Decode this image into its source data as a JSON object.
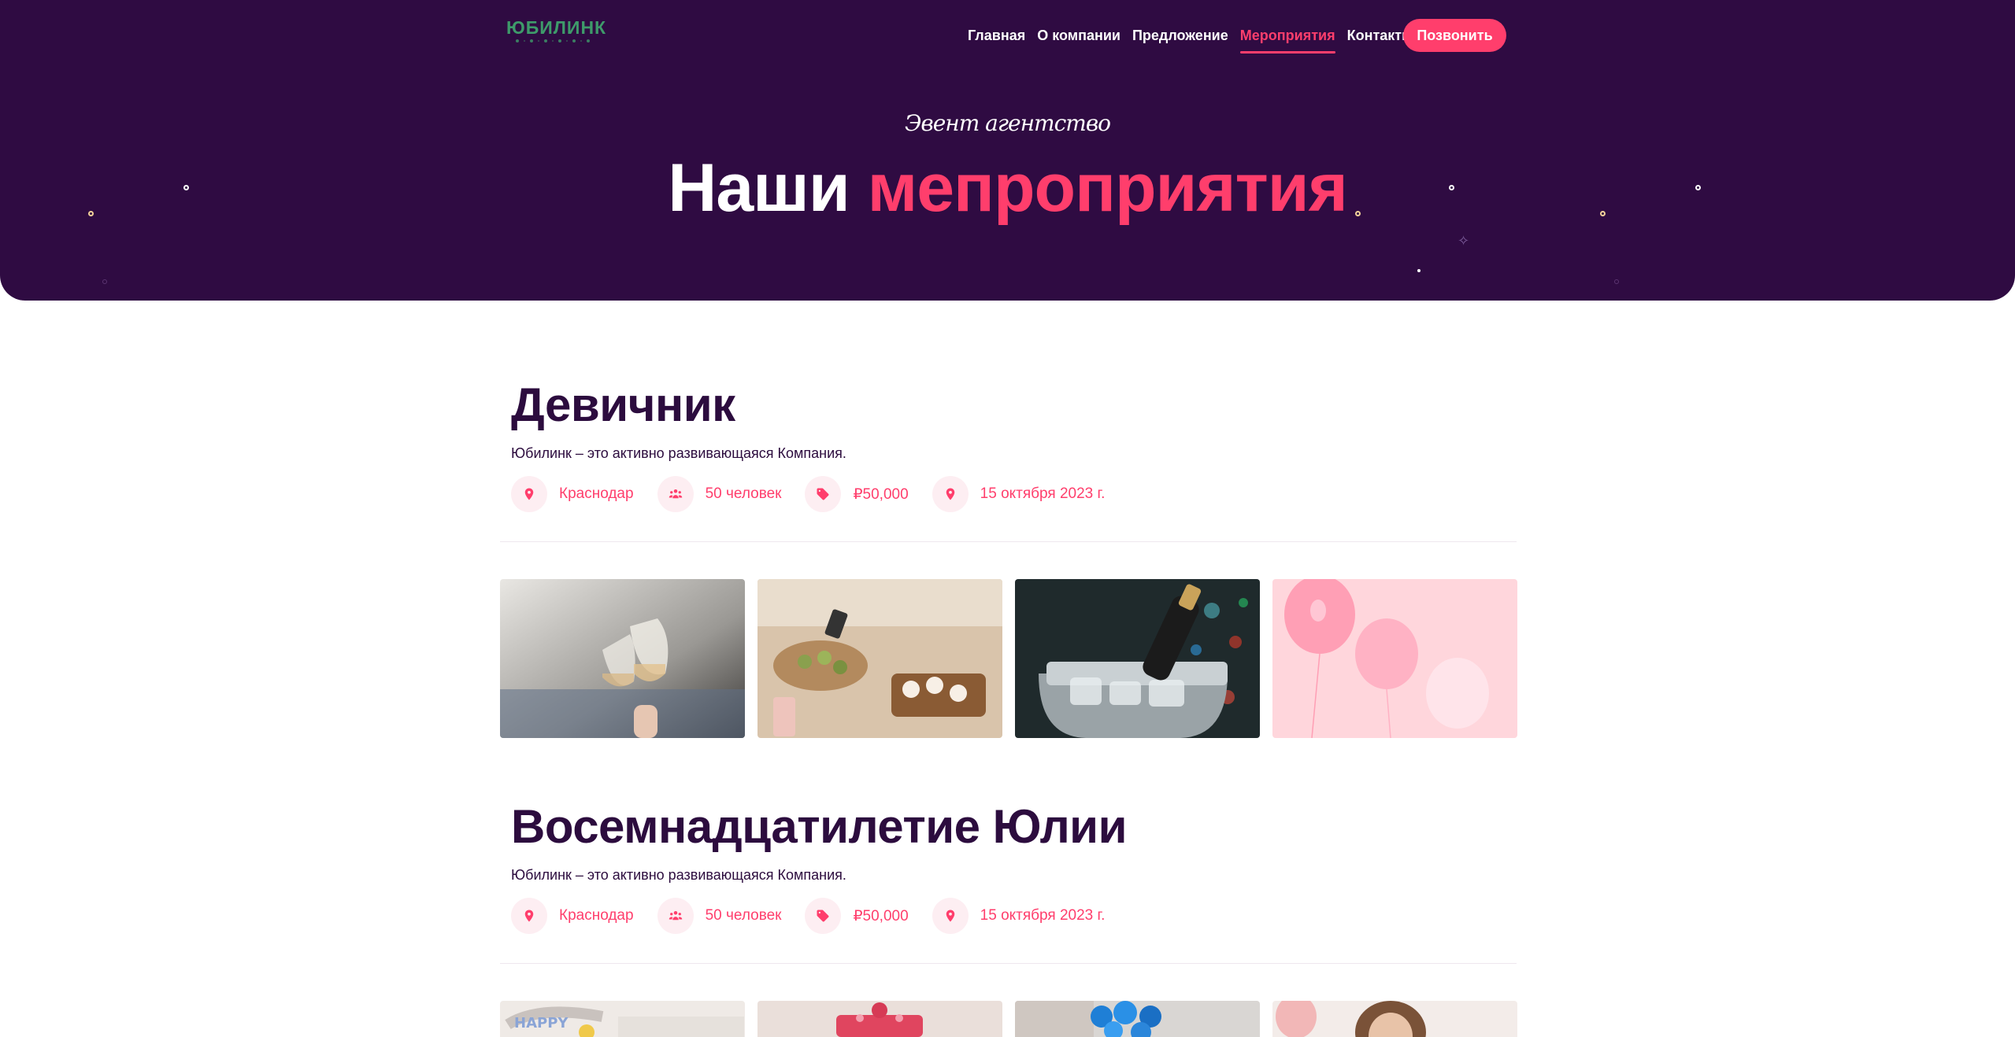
{
  "header": {
    "logo_text": "ЮБИЛИНК",
    "nav": [
      {
        "label": "Главная",
        "active": false
      },
      {
        "label": "О компании",
        "active": false
      },
      {
        "label": "Предложение",
        "active": false
      },
      {
        "label": "Мероприятия",
        "active": true
      },
      {
        "label": "Контакты",
        "active": false
      }
    ],
    "cta_label": "Позвонить"
  },
  "hero": {
    "subtitle": "Эвент агентство",
    "title_main": "Наши",
    "title_accent": "мепроприятия"
  },
  "events": [
    {
      "title": "Девичник",
      "description": "Юбилинк – это активно развивающаяся Компания.",
      "meta": [
        {
          "icon": "location-pin-icon",
          "text": "Краснодар"
        },
        {
          "icon": "people-icon",
          "text": "50 человек"
        },
        {
          "icon": "price-tag-icon",
          "text": "₽50,000"
        },
        {
          "icon": "location-pin-icon",
          "text": "15 октября 2023 г."
        }
      ],
      "photos": [
        "wine-glasses-toast-photo",
        "party-snacks-table-photo",
        "champagne-ice-bucket-photo",
        "pink-balloons-photo"
      ]
    },
    {
      "title": "Восемнадцатилетие Юлии",
      "description": "Юбилинк – это активно развивающаяся Компания.",
      "meta": [
        {
          "icon": "location-pin-icon",
          "text": "Краснодар"
        },
        {
          "icon": "people-icon",
          "text": "50 человек"
        },
        {
          "icon": "price-tag-icon",
          "text": "₽50,000"
        },
        {
          "icon": "location-pin-icon",
          "text": "15 октября 2023 г."
        }
      ],
      "photos": [
        "happy-birthday-decor-photo",
        "pink-cake-photo",
        "blue-balloons-photo",
        "smiling-woman-photo"
      ]
    }
  ],
  "colors": {
    "hero_bg": "#2f0b42",
    "accent": "#ff3e6c",
    "text_dark": "#2c0c3e",
    "logo_green": "#3e9a6a",
    "icon_bg": "#fdeef2"
  }
}
